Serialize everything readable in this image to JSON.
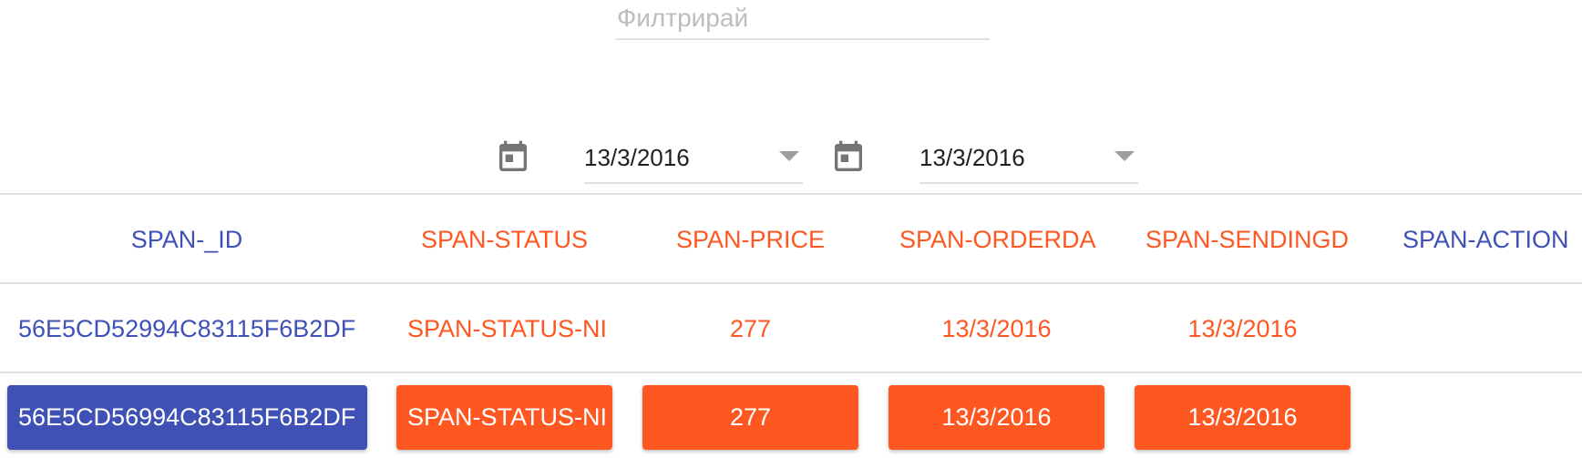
{
  "filter": {
    "placeholder": "Филтрирай",
    "value": ""
  },
  "date_from": {
    "value": "13/3/2016",
    "icon": "calendar-icon"
  },
  "date_to": {
    "value": "13/3/2016",
    "icon": "calendar-icon"
  },
  "table": {
    "headers": [
      "SPAN-_ID",
      "SPAN-STATUS",
      "SPAN-PRICE",
      "SPAN-ORDERDA",
      "SPAN-SENDINGD",
      "SPAN-ACTION"
    ],
    "rows": [
      [
        "56E5CD52994C83115F6B2DF",
        "SPAN-STATUS-NI",
        "277",
        "13/3/2016",
        "13/3/2016",
        ""
      ],
      [
        "56E5CD56994C83115F6B2DF",
        "SPAN-STATUS-NI",
        "277",
        "13/3/2016",
        "13/3/2016",
        ""
      ]
    ]
  },
  "colors": {
    "primary": "#3f51b5",
    "accent": "#ff5722"
  }
}
